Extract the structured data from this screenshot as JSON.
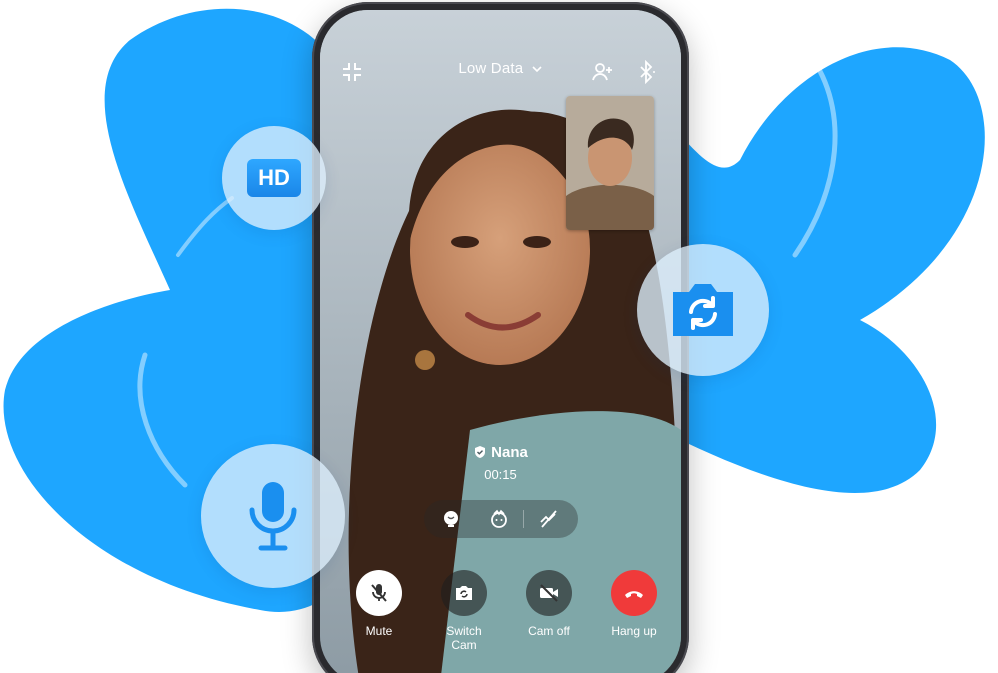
{
  "colors": {
    "brand_blue": "#1ea6ff",
    "bubble_bg": "#dceefc",
    "hangup_red": "#f03a3a",
    "icon_blue": "#1a8fef"
  },
  "header": {
    "shrink_icon": "minimize-icon",
    "data_mode_label": "Low Data",
    "add_user_icon": "add-user-icon",
    "bluetooth_icon": "bluetooth-icon"
  },
  "caller": {
    "name": "Nana",
    "duration": "00:15",
    "verified_icon": "shield-check-icon"
  },
  "effects": [
    {
      "icon": "beauty-icon"
    },
    {
      "icon": "face-effect-icon"
    },
    {
      "icon": "low-bandwidth-icon"
    }
  ],
  "controls": {
    "mute_label": "Mute",
    "switch_label": "Switch\nCam",
    "cam_off_label": "Cam off",
    "hang_up_label": "Hang up"
  },
  "features": {
    "hd_label": "HD",
    "switch_camera_icon": "camera-switch-icon",
    "microphone_icon": "microphone-icon"
  }
}
